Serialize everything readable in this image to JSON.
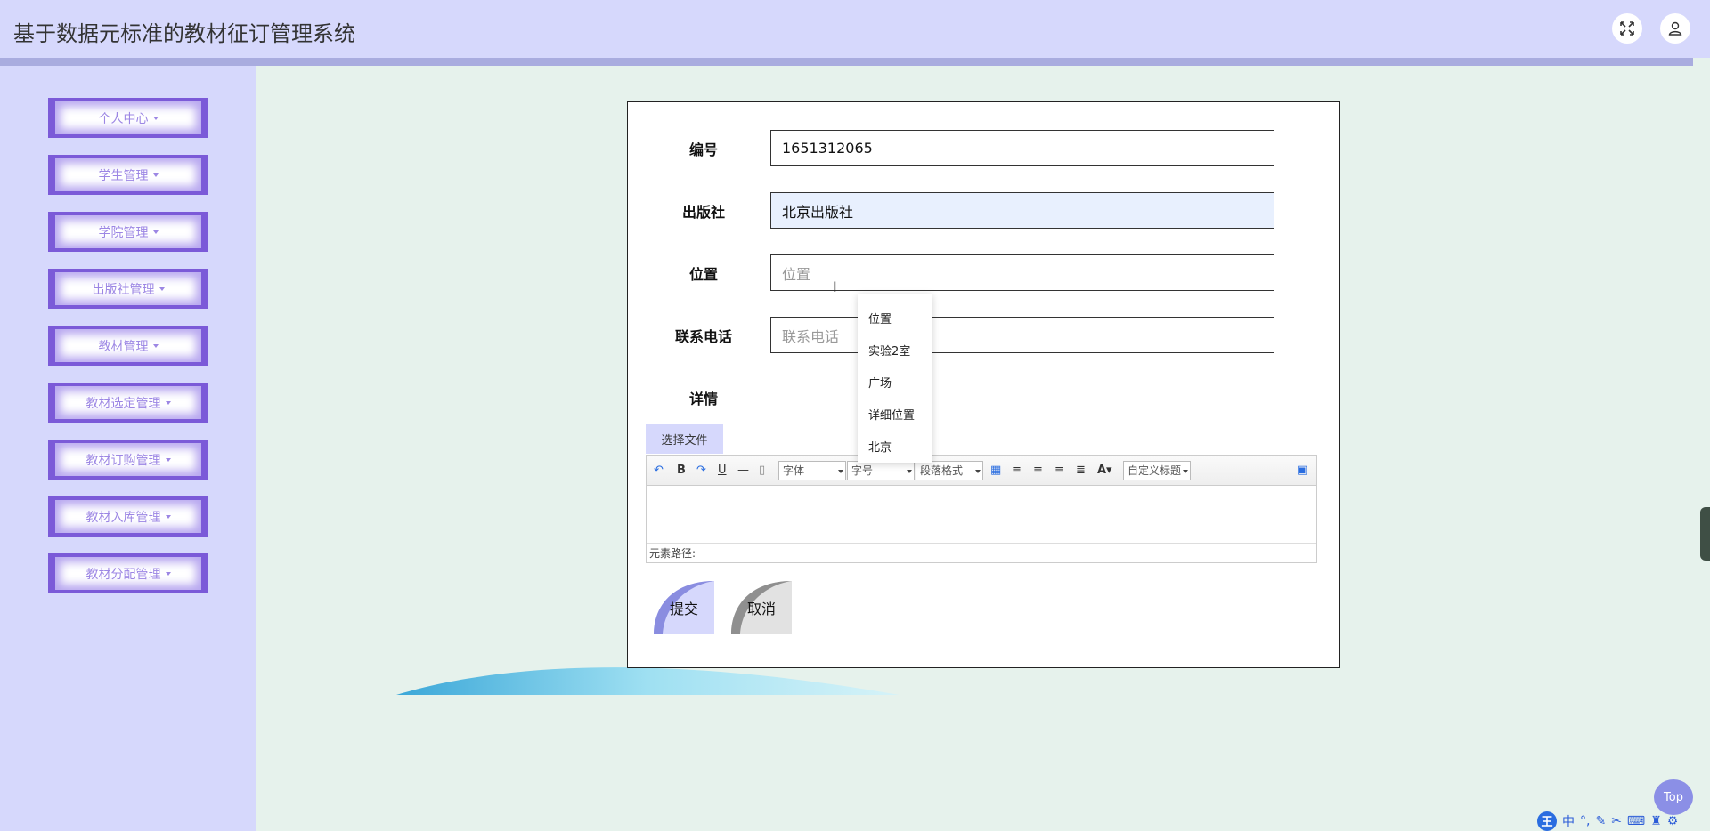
{
  "header": {
    "title": "基于数据元标准的教材征订管理系统"
  },
  "sidebar": {
    "items": [
      {
        "label": "个人中心"
      },
      {
        "label": "学生管理"
      },
      {
        "label": "学院管理"
      },
      {
        "label": "出版社管理"
      },
      {
        "label": "教材管理"
      },
      {
        "label": "教材选定管理"
      },
      {
        "label": "教材订购管理"
      },
      {
        "label": "教材入库管理"
      },
      {
        "label": "教材分配管理"
      }
    ]
  },
  "form": {
    "number": {
      "label": "编号",
      "value": "1651312065"
    },
    "publisher": {
      "label": "出版社",
      "value": "北京出版社"
    },
    "location": {
      "label": "位置",
      "placeholder": "位置"
    },
    "phone": {
      "label": "联系电话",
      "placeholder": "联系电话"
    },
    "details": {
      "label": "详情"
    },
    "file_button": "选择文件",
    "editor": {
      "font_combo": "字体",
      "size_combo": "字号",
      "paragraph_combo": "段落格式",
      "custom_combo": "自定义标题",
      "path_label": "元素路径:"
    },
    "submit": "提交",
    "cancel": "取消"
  },
  "autocomplete": {
    "options": [
      "位置",
      "实验2室",
      "广场",
      "详细位置",
      "北京"
    ]
  },
  "top_button": "Top",
  "ime": {
    "logo": "王",
    "mode": "中",
    "punct": "°,"
  }
}
